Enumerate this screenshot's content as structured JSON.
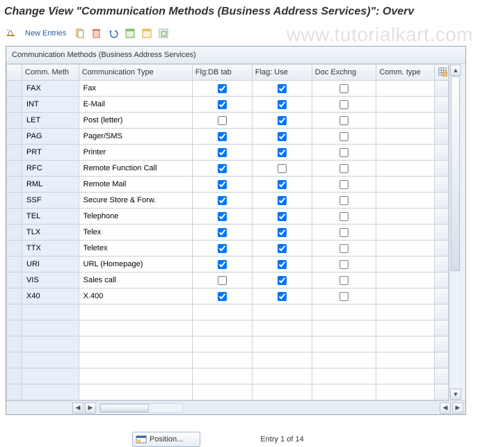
{
  "header": {
    "title": "Change View \"Communication Methods (Business Address Services)\": Overv"
  },
  "toolbar": {
    "new_entries_label": "New Entries"
  },
  "watermark_text": "www.tutorialkart.com",
  "grid": {
    "panel_title": "Communication Methods (Business Address Services)",
    "columns": {
      "comm_meth": "Comm. Meth",
      "comm_type_label": "Communication Type",
      "flg_db_tab": "Flg:DB tab",
      "flag_use": "Flag: Use",
      "doc_exchng": "Doc Exchng",
      "comm_type": "Comm. type"
    },
    "rows": [
      {
        "code": "FAX",
        "type": "Fax",
        "db": true,
        "use": true,
        "doc": false,
        "ct": ""
      },
      {
        "code": "INT",
        "type": "E-Mail",
        "db": true,
        "use": true,
        "doc": false,
        "ct": ""
      },
      {
        "code": "LET",
        "type": "Post (letter)",
        "db": false,
        "use": true,
        "doc": false,
        "ct": ""
      },
      {
        "code": "PAG",
        "type": "Pager/SMS",
        "db": true,
        "use": true,
        "doc": false,
        "ct": ""
      },
      {
        "code": "PRT",
        "type": "Printer",
        "db": true,
        "use": true,
        "doc": false,
        "ct": ""
      },
      {
        "code": "RFC",
        "type": "Remote Function Call",
        "db": true,
        "use": false,
        "doc": false,
        "ct": ""
      },
      {
        "code": "RML",
        "type": "Remote Mail",
        "db": true,
        "use": true,
        "doc": false,
        "ct": ""
      },
      {
        "code": "SSF",
        "type": "Secure Store & Forw.",
        "db": true,
        "use": true,
        "doc": false,
        "ct": ""
      },
      {
        "code": "TEL",
        "type": "Telephone",
        "db": true,
        "use": true,
        "doc": false,
        "ct": ""
      },
      {
        "code": "TLX",
        "type": "Telex",
        "db": true,
        "use": true,
        "doc": false,
        "ct": ""
      },
      {
        "code": "TTX",
        "type": "Teletex",
        "db": true,
        "use": true,
        "doc": false,
        "ct": ""
      },
      {
        "code": "URI",
        "type": "URL (Homepage)",
        "db": true,
        "use": true,
        "doc": false,
        "ct": ""
      },
      {
        "code": "VIS",
        "type": "Sales call",
        "db": false,
        "use": true,
        "doc": false,
        "ct": ""
      },
      {
        "code": "X40",
        "type": "X.400",
        "db": true,
        "use": true,
        "doc": false,
        "ct": ""
      }
    ],
    "empty_rows": 6
  },
  "footer": {
    "position_label": "Position...",
    "entry_status": "Entry 1 of 14"
  }
}
